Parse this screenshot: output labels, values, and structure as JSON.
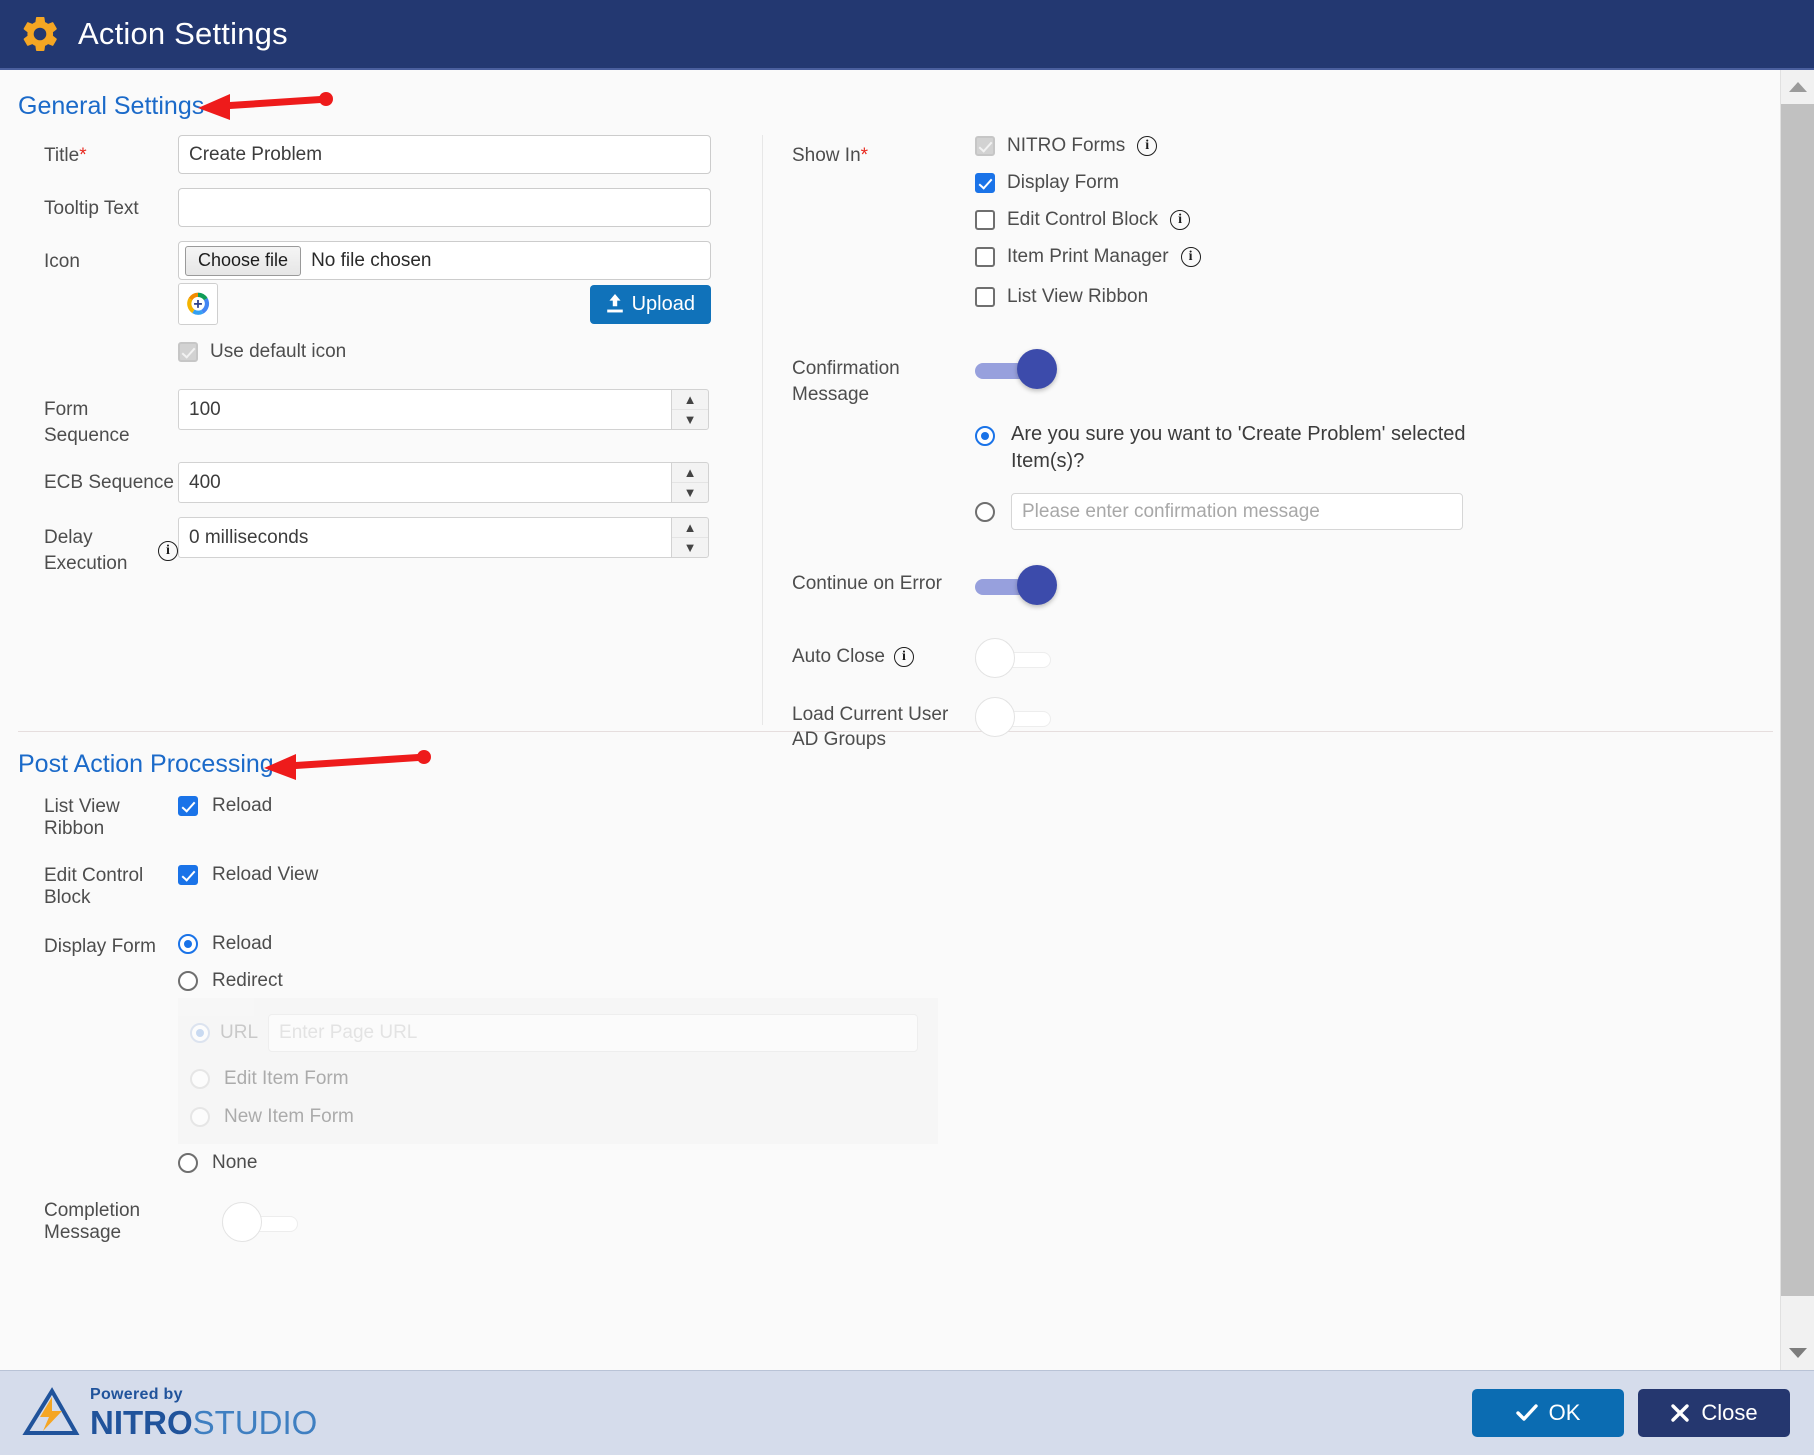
{
  "header": {
    "title": "Action Settings",
    "icon": "gear-icon"
  },
  "sections": {
    "general": "General Settings",
    "post_action": "Post Action Processing"
  },
  "general": {
    "title": {
      "label": "Title",
      "required": "*",
      "value": "Create Problem"
    },
    "tooltip": {
      "label": "Tooltip Text",
      "value": ""
    },
    "icon": {
      "label": "Icon",
      "choose_file": "Choose file",
      "no_file": "No file chosen",
      "upload": "Upload",
      "use_default": "Use default icon",
      "use_default_checked": true
    },
    "form_sequence": {
      "label": "Form Sequence",
      "value": "100"
    },
    "ecb_sequence": {
      "label": "ECB Sequence",
      "value": "400"
    },
    "delay_execution": {
      "label": "Delay Execution",
      "value": "0 milliseconds"
    }
  },
  "show_in": {
    "label": "Show In",
    "required": "*",
    "items": [
      {
        "label": "NITRO Forms",
        "checked": true,
        "disabled": true,
        "info": true
      },
      {
        "label": "Display Form",
        "checked": true,
        "disabled": false,
        "info": false
      },
      {
        "label": "Edit Control Block",
        "checked": false,
        "disabled": false,
        "info": true
      },
      {
        "label": "Item Print Manager",
        "checked": false,
        "disabled": false,
        "info": true
      },
      {
        "label": "List View Ribbon",
        "checked": false,
        "disabled": false,
        "info": false
      }
    ]
  },
  "confirmation": {
    "label_line1": "Confirmation",
    "label_line2": "Message",
    "enabled": true,
    "option_default": "Are you sure you want to 'Create Problem' selected Item(s)?",
    "option_default_selected": true,
    "option_custom_placeholder": "Please enter confirmation message",
    "option_custom_value": "",
    "option_custom_selected": false
  },
  "continue_on_error": {
    "label": "Continue on Error",
    "enabled": true
  },
  "auto_close": {
    "label": "Auto Close",
    "enabled": false,
    "info": true
  },
  "load_ad_groups": {
    "label_line1": "Load Current User",
    "label_line2": "AD Groups",
    "enabled": false
  },
  "post_action": {
    "list_view_ribbon": {
      "label": "List View Ribbon",
      "option": "Reload",
      "checked": true
    },
    "edit_control_block": {
      "label": "Edit Control Block",
      "option": "Reload View",
      "checked": true
    },
    "display_form": {
      "label": "Display Form",
      "options": [
        {
          "label": "Reload",
          "selected": true
        },
        {
          "label": "Redirect",
          "selected": false
        },
        {
          "label": "None",
          "selected": false
        }
      ],
      "redirect_panel": {
        "url_label": "URL",
        "url_placeholder": "Enter Page URL",
        "url_value": "",
        "url_selected": true,
        "edit_item_form": "Edit Item Form",
        "new_item_form": "New Item Form"
      }
    },
    "completion_message": {
      "label": "Completion Message",
      "enabled": false
    }
  },
  "footer": {
    "logo_powered": "Powered by",
    "logo_nitro": "NITRO",
    "logo_studio": "STUDIO",
    "ok": "OK",
    "close": "Close"
  },
  "colors": {
    "header_bg": "#233871",
    "accent_link": "#1b6ac9",
    "checkbox_blue": "#1a73e8",
    "toggle_on": "#3c4bab",
    "upload_blue": "#1072ba",
    "annotation_red": "#ee1b1b",
    "footer_bg": "#d5dceb"
  }
}
